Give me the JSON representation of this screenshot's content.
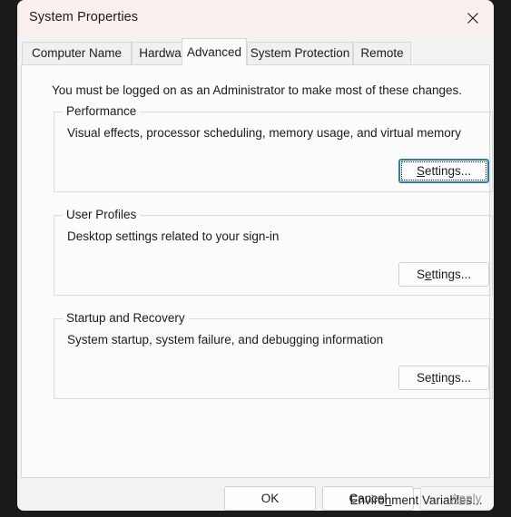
{
  "window": {
    "title": "System Properties",
    "close_icon": "close-icon",
    "titlebar_color": "#f9f0ed",
    "body_color": "#f3f3f3",
    "focus_color": "#2a7fa0"
  },
  "tabs": [
    {
      "label": "Computer Name",
      "active": false
    },
    {
      "label": "Hardware",
      "active": false
    },
    {
      "label": "Advanced",
      "active": true
    },
    {
      "label": "System Protection",
      "active": false
    },
    {
      "label": "Remote",
      "active": false
    }
  ],
  "main": {
    "admin_note": "You must be logged on as an Administrator to make most of these changes.",
    "groups": [
      {
        "legend": "Performance",
        "description": "Visual effects, processor scheduling, memory usage, and virtual memory",
        "button": {
          "label": "Settings...",
          "accelerator": "S",
          "prefix": "",
          "suffix": "ettings...",
          "focused": true,
          "disabled": false
        }
      },
      {
        "legend": "User Profiles",
        "description": "Desktop settings related to your sign-in",
        "button": {
          "label": "Settings...",
          "accelerator": "e",
          "prefix": "S",
          "suffix": "ttings...",
          "focused": false,
          "disabled": false
        }
      },
      {
        "legend": "Startup and Recovery",
        "description": "System startup, system failure, and debugging information",
        "button": {
          "label": "Settings...",
          "accelerator": "t",
          "prefix": "Se",
          "suffix": "tings...",
          "focused": false,
          "disabled": false
        }
      }
    ],
    "environment_button": {
      "label": "Environment Variables...",
      "accelerator": "n",
      "prefix": "Enviro",
      "suffix": "ment Variables..."
    }
  },
  "footer": {
    "ok": {
      "label": "OK",
      "disabled": false
    },
    "cancel": {
      "label": "Cancel",
      "disabled": false
    },
    "apply": {
      "label": "Apply",
      "accelerator": "A",
      "prefix": "",
      "suffix": "pply",
      "disabled": true
    }
  }
}
